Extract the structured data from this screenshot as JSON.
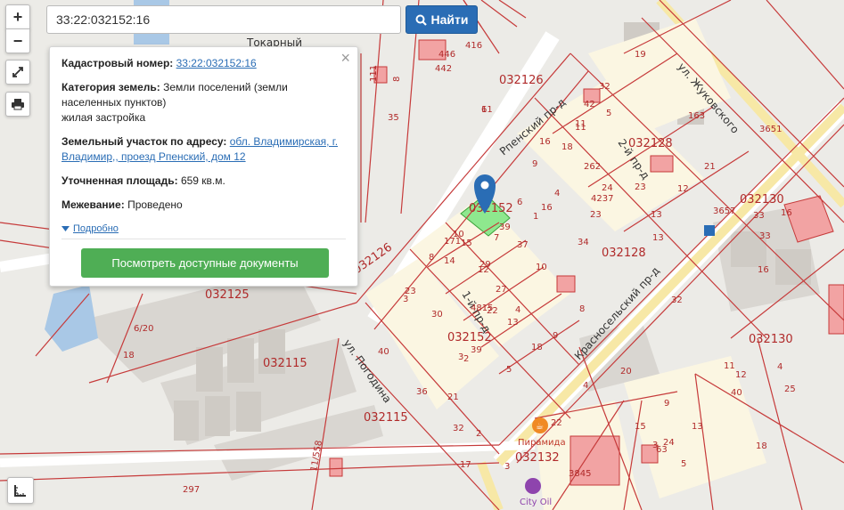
{
  "search": {
    "value": "33:22:032152:16",
    "button_label": "Найти"
  },
  "controls": {
    "zoom_in": "+",
    "zoom_out": "−"
  },
  "popup": {
    "cadastral_label": "Кадастровый номер:",
    "cadastral_value": "33:22:032152:16",
    "category_label": "Категория земель:",
    "category_value": "Земли поселений (земли населенных пунктов)",
    "category_subvalue": "жилая застройка",
    "address_label": "Земельный участок по адресу:",
    "address_value": "обл. Владимирская, г. Владимир,, проезд Рпенский, дом 12",
    "area_label": "Уточненная площадь:",
    "area_value": "659 кв.м.",
    "survey_label": "Межевание:",
    "survey_value": "Проведено",
    "more_link": "Подробно",
    "docs_button": "Посмотреть доступные документы"
  },
  "map": {
    "streets": [
      "ул. Жуковского",
      "Красносельский пр-д",
      "ул. Погодина",
      "2-й пр-д",
      "1-й пр-д",
      "Рпенский пр-д",
      "Токарный"
    ],
    "blocks": [
      "032126",
      "032128",
      "032128",
      "032130",
      "032130",
      "032125",
      "032115",
      "032115",
      "032152",
      "032132",
      "032152"
    ],
    "pois": [
      "Пирамида",
      "City Oil"
    ],
    "parcel_numbers": [
      "446",
      "442",
      "416",
      "19",
      "32",
      "42",
      "163",
      "3651",
      "11",
      "16",
      "18",
      "6",
      "262",
      "21",
      "24",
      "13",
      "12",
      "27",
      "30",
      "1",
      "29",
      "4",
      "8",
      "12",
      "7",
      "11",
      "5",
      "9",
      "16",
      "37",
      "39",
      "10",
      "15",
      "14",
      "3",
      "22",
      "4815",
      "4",
      "16",
      "33",
      "16",
      "33",
      "3657",
      "32",
      "8",
      "23",
      "34",
      "18",
      "13",
      "23",
      "10",
      "13",
      "2",
      "39",
      "40",
      "36",
      "21",
      "32",
      "5",
      "9",
      "20",
      "4",
      "15",
      "22",
      "3",
      "24",
      "13",
      "5",
      "9",
      "25",
      "4",
      "11",
      "12",
      "40",
      "18",
      "3845",
      "63",
      "3",
      "17",
      "297",
      "11/558",
      "6/20",
      "18",
      "35",
      "111",
      "8",
      "171",
      "11",
      "6",
      "4237",
      "23",
      "3",
      "2",
      "3"
    ]
  }
}
